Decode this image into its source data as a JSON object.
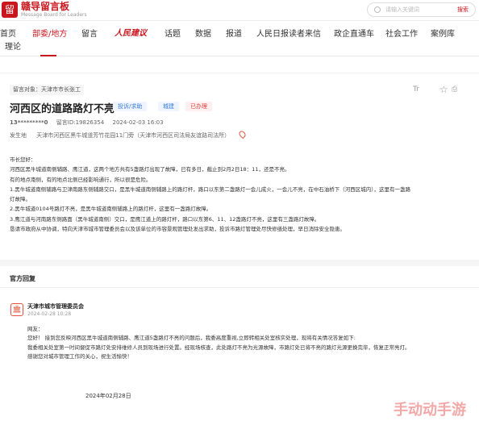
{
  "brand": {
    "title": "赣导留言板",
    "subtitle": "Message Board for Leaders"
  },
  "search": {
    "placeholder": "请输入关键词",
    "button": "搜索"
  },
  "nav": [
    "首页",
    "部委/地方",
    "留言",
    "人民建议",
    "话题",
    "数据",
    "报道",
    "人民日报读者来信",
    "政企直通车",
    "社会工作",
    "案例库",
    "理论"
  ],
  "message": {
    "target_label": "留言对象：",
    "target": "天津市市长张工",
    "title": "河西区的道路路灯不亮",
    "badges": [
      "投诉/求助",
      "城建",
      "已办理"
    ],
    "author": "13*********0",
    "id": "留言ID:19826354",
    "date": "2024-02-03 16:03",
    "place_label": "发生地",
    "place": "天津市河西区黑牛城道芳竹花园11门旁（天津市河西区司法局友谊路司法所）",
    "icon_size": "Tr",
    "body": [
      "市长您好：",
      "    河西区黑牛城道南侧辅路、鹰江道，这两个地方共有5盏路灯出现了故障，已有多日，截止到2月2日18：11，还是不亮。",
      "    有的地点南侧，有的地点北侧已经影响通行，所以很是危险。",
      "    1.黑牛城道南侧辅路与卫津南路东侧辅路交口，是黑牛城道南侧辅路上的路灯杆，路口以东第二盏路灯一会儿成火，一会儿不亮，在中石油桥下（河西区城内），这里有一盏路",
      "灯故障。",
      "    2.黑牛城道0104号路灯不亮，是黑牛城道南侧辅路上的路灯杆，这里有一盏路灯故障。",
      "    3.鹰江道与河南路东侧路面（黑牛城道南侧）交口，是鹰江道上的路灯杆，路口以东第6、11、12盏路灯不亮，这里有三盏路灯故障。",
      "    恳请市政府从中协调，特向天津市城市管理委员会以及该单位的市容景观管理处发出求助，投诉市路灯管理处尽快修缮处理，早日消除安全隐患。"
    ]
  },
  "official": {
    "section": "官方回复",
    "org": "天津市城市管理委员会",
    "time": "2024-02-28 10:28",
    "reply": [
      "网友：",
      "您好！ 接到您反映河西区黑牛城道南侧辅路、鹰江道5盏路灯不亮的问题后，我委高度重视,立即转相关处室核实处理，现将有关情况答复如下:",
      "我委相关处室第一时间督促市路灯处安排维修人员到现场进行处置。经现场核查，此处路灯不亮为光源故障，市路灯处已将不亮的路灯光源更换完毕，恢复正常亮灯。",
      "感谢您对城市管理工作的关心，祝生活愉快！"
    ],
    "date": "2024年02月28日"
  },
  "watermark": "手动动手游"
}
